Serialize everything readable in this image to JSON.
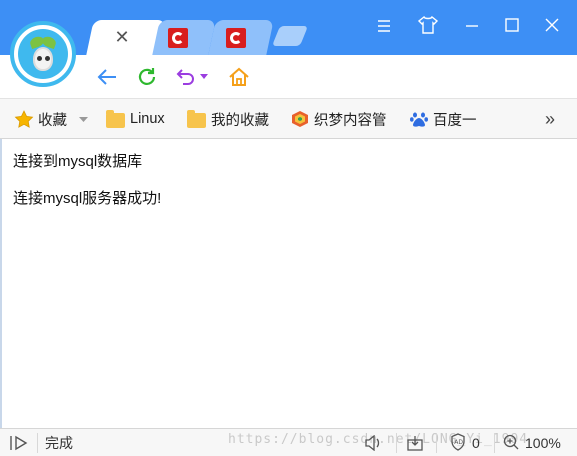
{
  "browser": {
    "tabs": [
      {
        "name": "active-tab",
        "close_glyph": "✕"
      },
      {
        "name": "tab-2",
        "icon": "c-icon"
      },
      {
        "name": "tab-3",
        "icon": "c-icon"
      }
    ],
    "window_controls": [
      "menu-icon",
      "skin-icon",
      "minimize-icon",
      "maximize-icon",
      "close-icon"
    ]
  },
  "nav": {
    "icons": [
      "back-icon",
      "refresh-icon",
      "undo-icon",
      "dropdown-icon",
      "home-icon"
    ]
  },
  "bookmarks": {
    "items": [
      {
        "label": "收藏",
        "icon": "star-icon"
      },
      {
        "label": "Linux",
        "icon": "folder-icon"
      },
      {
        "label": "我的收藏",
        "icon": "folder-icon"
      },
      {
        "label": "织梦内容管",
        "icon": "dedecms-icon"
      },
      {
        "label": "百度一",
        "icon": "baidu-paw-icon"
      }
    ],
    "more_glyph": "»"
  },
  "page": {
    "lines": [
      "连接到mysql数据库",
      "连接mysql服务器成功!"
    ]
  },
  "status": {
    "text": "完成",
    "watermark": "https://blog.csdn.net/LONG_Yi_1994",
    "ad_count": "0",
    "zoom": "100%"
  },
  "colors": {
    "titlebar": "#3d8ff5",
    "accent": "#3fb9ee"
  }
}
